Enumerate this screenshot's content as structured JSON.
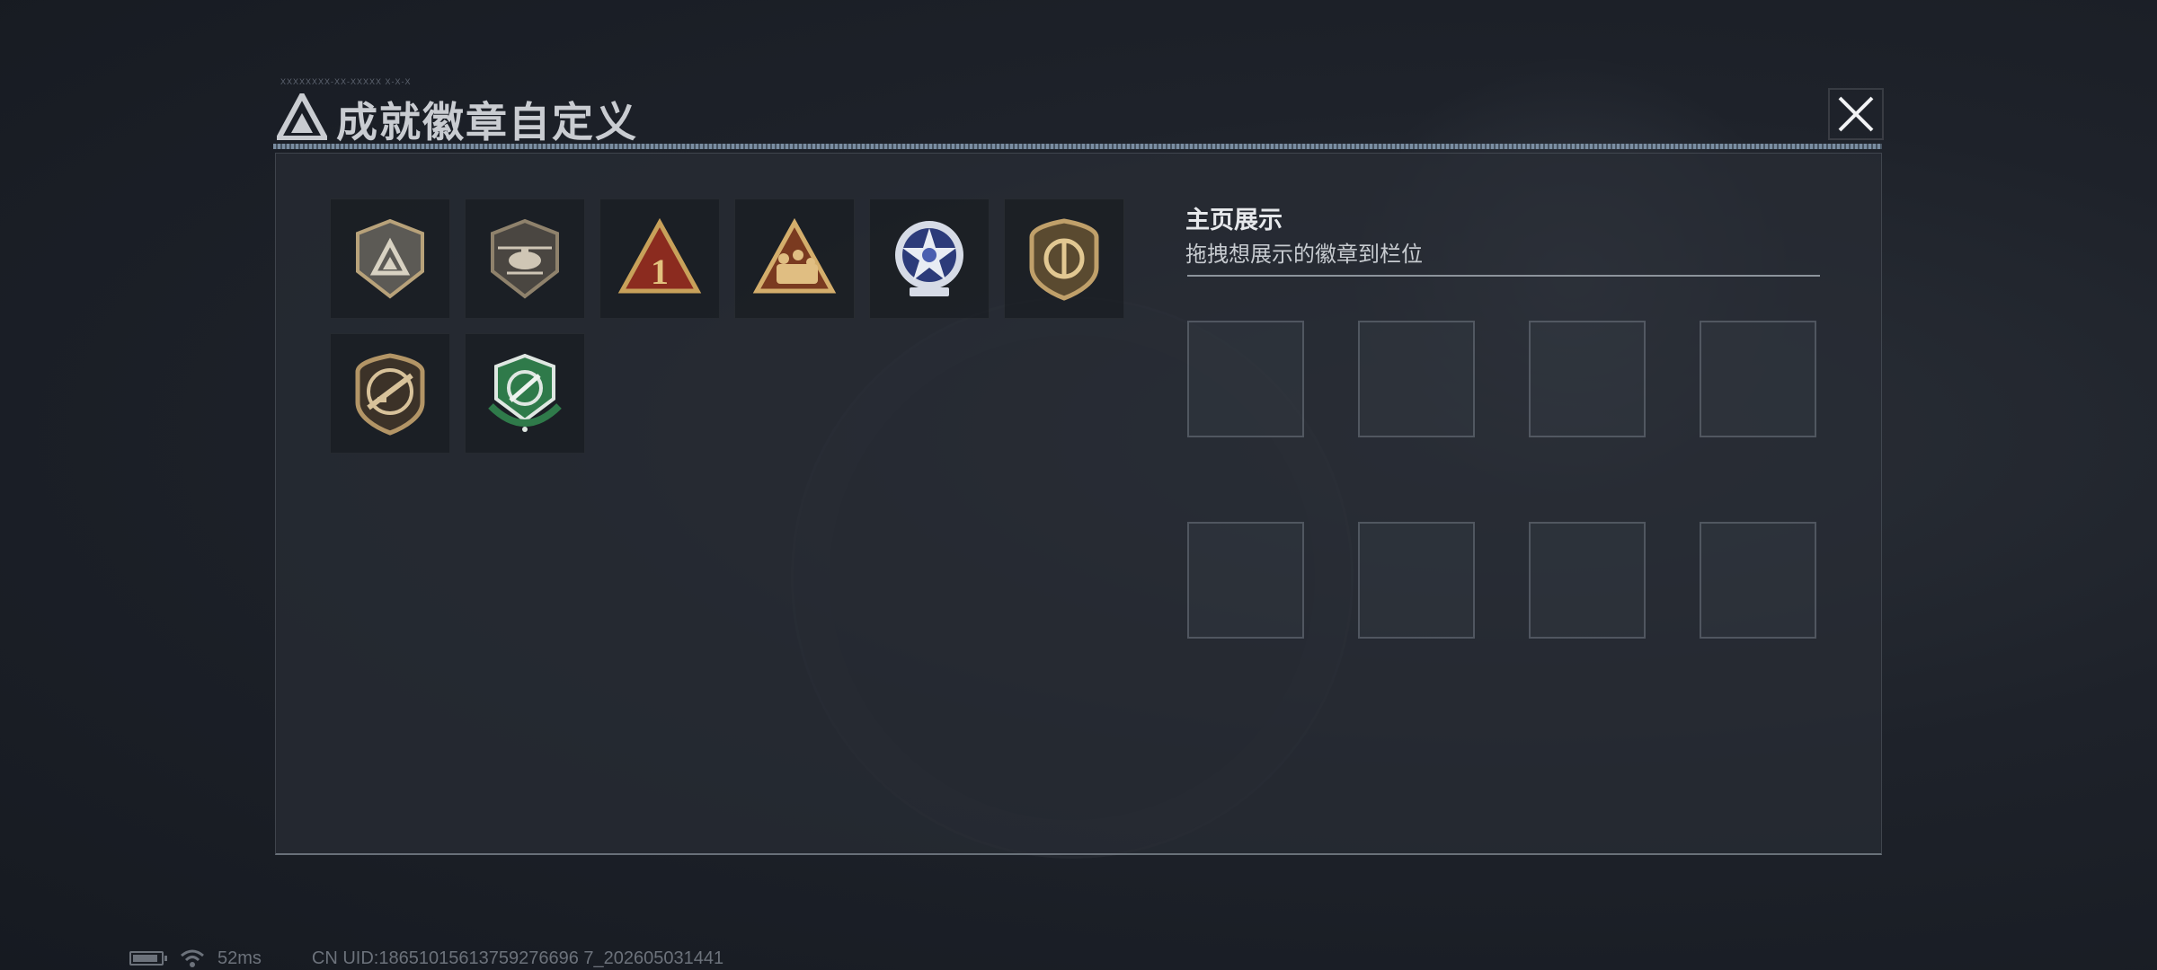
{
  "window": {
    "title": "成就徽章自定义",
    "title_small": "XXXXXXXX-XX-XXXXX X-X-X"
  },
  "badges": [
    {
      "name": "elite-triangle-shield-icon",
      "colors": {
        "main": "#b8a27a",
        "inner": "#5c5a55"
      }
    },
    {
      "name": "helicopter-shield-icon",
      "colors": {
        "main": "#8f826c",
        "inner": "#4a4641"
      }
    },
    {
      "name": "number-one-triangle-icon",
      "colors": {
        "main": "#c8a15a",
        "inner": "#8b2b1f"
      },
      "label": "1"
    },
    {
      "name": "squad-triangle-icon",
      "colors": {
        "main": "#d4ae6c",
        "inner": "#7a3a20"
      }
    },
    {
      "name": "star-emblem-icon",
      "colors": {
        "main": "#d6dbe6",
        "inner": "#2c3b7a"
      }
    },
    {
      "name": "round-shield-icon",
      "colors": {
        "main": "#c0a06a",
        "inner": "#5a4a30"
      }
    },
    {
      "name": "rifle-shield-icon",
      "colors": {
        "main": "#b39566",
        "inner": "#3c3228"
      }
    },
    {
      "name": "green-knife-badge-icon",
      "colors": {
        "main": "#dfe7e2",
        "inner": "#2f7a4a"
      }
    }
  ],
  "showcase": {
    "title": "主页展示",
    "subtitle": "拖拽想展示的徽章到栏位",
    "slots": 8
  },
  "status": {
    "battery_level": 0.9,
    "ping": "52ms",
    "uid": "CN UID:18651015613759276696 7_202605031441"
  }
}
